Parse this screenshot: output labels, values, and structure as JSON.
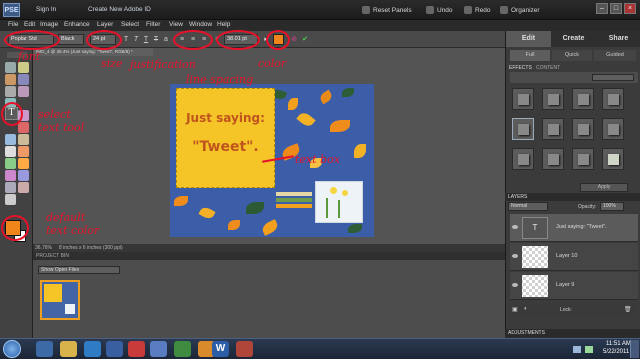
{
  "app": {
    "logo_text": "PSE",
    "sign_in": "Sign In",
    "create_id": "Create New Adobe ID",
    "reset_panels": "Reset Panels",
    "undo": "Undo",
    "redo": "Redo",
    "organizer": "Organizer"
  },
  "menu": [
    "File",
    "Edit",
    "Image",
    "Enhance",
    "Layer",
    "Select",
    "Filter",
    "View",
    "Window",
    "Help"
  ],
  "options": {
    "font_family": "Poplar Std",
    "font_style": "Black",
    "font_size": "24 pt",
    "leading": "38.01 pt",
    "text_color": "#f0861b"
  },
  "document": {
    "tab_title": "IMG_4 @ 36.4% (Just saying: \"Tweet\", RGB/8) *",
    "note_line1": "Just saying:",
    "note_line2": "\"Tweet\".",
    "zoom": "36.76%",
    "doc_size": "8 inches x 6 inches (300 ppi)"
  },
  "project_bin": {
    "header": "PROJECT BIN",
    "select_label": "Show Open Files"
  },
  "panel": {
    "tabs": [
      "Edit",
      "Create",
      "Share"
    ],
    "subtabs": [
      "Full",
      "Quick",
      "Guided"
    ],
    "effects_header": "EFFECTS",
    "content_header": "CONTENT",
    "apply": "Apply",
    "layers_header": "LAYERS",
    "blend_mode": "Normal",
    "opacity_label": "Opacity:",
    "opacity_value": "100%",
    "lock_label": "Lock:",
    "layers": [
      "Just saying: \"Tweet\".",
      "Layer 10",
      "Layer 9"
    ],
    "adjustments_header": "ADJUSTMENTS"
  },
  "annotations": {
    "font": "font",
    "size": "size",
    "justification": "justification",
    "line_spacing": "line spacing",
    "color": "color",
    "select_text_tool": "select\ntext tool",
    "text_box": "text box",
    "default_text_color": "default\ntext color",
    "ann_color": "#e8112a"
  },
  "taskbar": {
    "time": "11:51 AM",
    "date": "5/22/2011"
  }
}
